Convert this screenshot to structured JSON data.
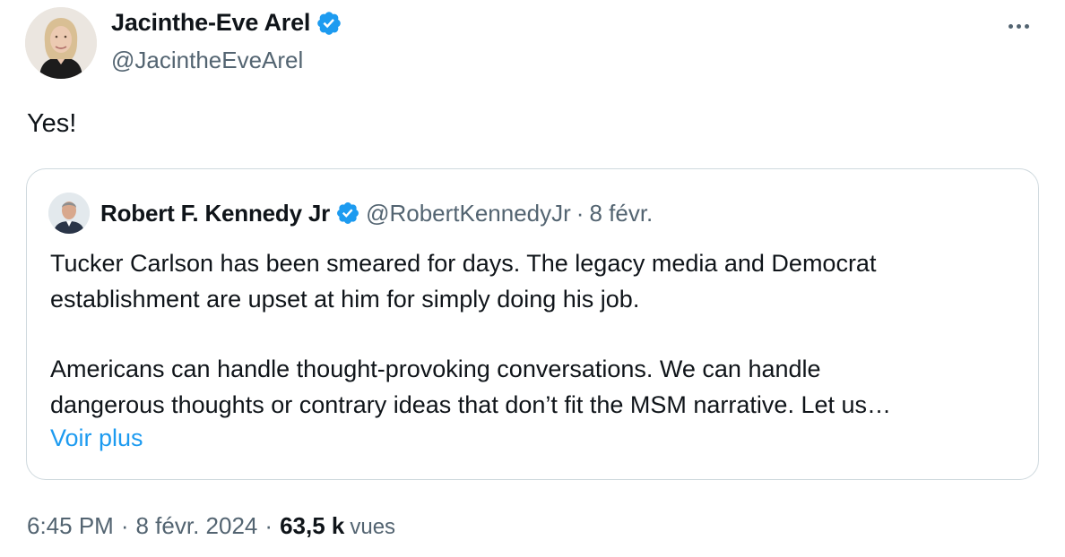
{
  "author": {
    "display_name": "Jacinthe-Eve Arel",
    "handle": "@JacintheEveArel",
    "verified_icon": "verified-badge-icon",
    "avatar": "profile-photo-avatar"
  },
  "more_icon": "more-horizontal-icon",
  "tweet": {
    "text": "Yes!"
  },
  "quoted": {
    "display_name": "Robert F. Kennedy Jr",
    "handle": "@RobertKennedyJr",
    "separator": "·",
    "date": "8 févr.",
    "lines": [
      "Tucker Carlson has been smeared for days. The legacy media and Democrat",
      "establishment are upset at him for simply doing his job.",
      "",
      "Americans can handle thought-provoking conversations. We can handle",
      "dangerous thoughts or contrary ideas that don’t fit the MSM narrative. Let us…"
    ],
    "show_more": "Voir plus"
  },
  "meta": {
    "time": "6:45 PM",
    "sep1": "·",
    "date": "8 févr. 2024",
    "sep2": "·",
    "views_count": "63,5 k",
    "views_label": "vues"
  },
  "colors": {
    "link": "#1d9bf0",
    "secondary_text": "#536471",
    "border": "#cfd9de",
    "primary_text": "#0f1419"
  }
}
